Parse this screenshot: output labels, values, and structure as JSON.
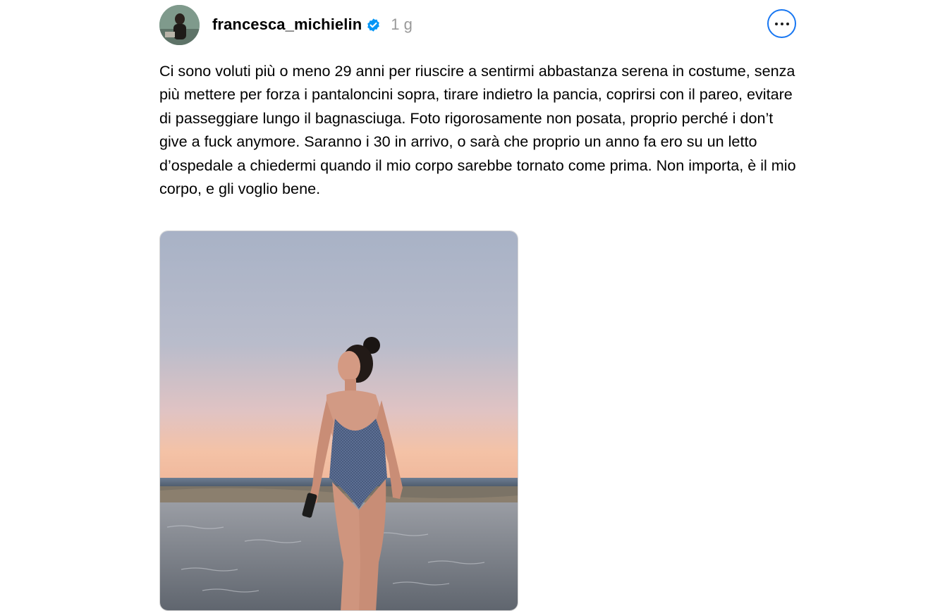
{
  "post": {
    "author": {
      "username": "francesca_michielin",
      "verified": true,
      "avatar_icon": "avatar-photo",
      "verified_icon": "verified-badge-icon"
    },
    "time_ago": "1 g",
    "more_icon": "more-options-icon",
    "caption": "Ci sono voluti più o meno 29 anni per riuscire a sentirmi abbastanza serena in costume, senza più mettere per forza i pantaloncini sopra, tirare indietro la pancia, coprirsi con il pareo, evitare di passeggiare lungo il bagnasciuga. Foto rigorosamente non posata, proprio perché i don’t give a fuck anymore. Saranno i 30 in arrivo, o sarà che proprio un anno fa ero su un letto d’ospedale a chiedermi quando il mio corpo sarebbe tornato come prima. Non importa, è il mio corpo, e gli voglio bene.",
    "photo_icon": "beach-photo"
  },
  "colors": {
    "accent": "#1877f2",
    "muted_text": "#999999",
    "verified": "#0095f6"
  }
}
